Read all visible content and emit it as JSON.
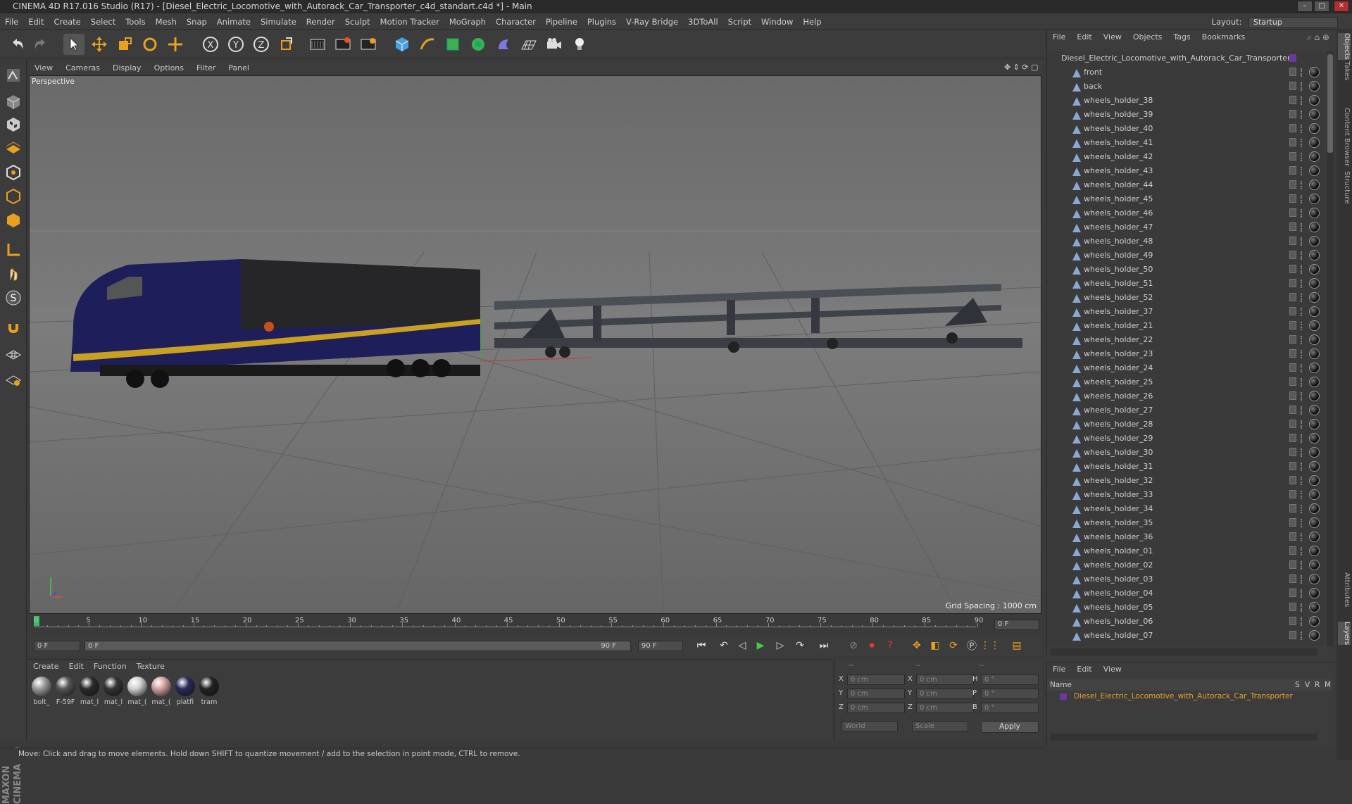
{
  "app": {
    "title": "CINEMA 4D R17.016 Studio (R17) - [Diesel_Electric_Locomotive_with_Autorack_Car_Transporter_c4d_standart.c4d *] - Main"
  },
  "menubar": [
    "File",
    "Edit",
    "Create",
    "Select",
    "Tools",
    "Mesh",
    "Snap",
    "Animate",
    "Simulate",
    "Render",
    "Sculpt",
    "Motion Tracker",
    "MoGraph",
    "Character",
    "Pipeline",
    "Plugins",
    "V-Ray Bridge",
    "3DToAll",
    "Script",
    "Window",
    "Help"
  ],
  "layout": {
    "label": "Layout:",
    "value": "Startup"
  },
  "viewport": {
    "menu": [
      "View",
      "Cameras",
      "Display",
      "Options",
      "Filter",
      "Panel"
    ],
    "label": "Perspective",
    "grid_spacing": "Grid Spacing : 1000 cm"
  },
  "timeline": {
    "ticks": [
      "0",
      "5",
      "10",
      "15",
      "20",
      "25",
      "30",
      "35",
      "40",
      "45",
      "50",
      "55",
      "60",
      "65",
      "70",
      "75",
      "80",
      "85",
      "90"
    ],
    "frame_field": "0 F"
  },
  "transport": {
    "start": "0 F",
    "range_start": "0 F",
    "range_end": "90 F",
    "end": "90 F"
  },
  "materials": {
    "menu": [
      "Create",
      "Edit",
      "Function",
      "Texture"
    ],
    "items": [
      {
        "name": "bolt_",
        "color": "#9a9a9a"
      },
      {
        "name": "F-59F",
        "color": "#555"
      },
      {
        "name": "mat_l",
        "color": "#2a2a2a"
      },
      {
        "name": "mat_l",
        "color": "#333"
      },
      {
        "name": "mat_(",
        "color": "#cfcfcf"
      },
      {
        "name": "mat_(",
        "color": "#d4a0a0"
      },
      {
        "name": "platfi",
        "color": "#2a2a5a"
      },
      {
        "name": "tram",
        "color": "#222"
      }
    ]
  },
  "coords": {
    "rows": [
      {
        "a": "X",
        "av": "0 cm",
        "b": "X",
        "bv": "0 cm",
        "c": "H",
        "cv": "0 °"
      },
      {
        "a": "Y",
        "av": "0 cm",
        "b": "Y",
        "bv": "0 cm",
        "c": "P",
        "cv": "0 °"
      },
      {
        "a": "Z",
        "av": "0 cm",
        "b": "Z",
        "bv": "0 cm",
        "c": "B",
        "cv": "0 °"
      }
    ],
    "world": "World",
    "scale": "Scale",
    "apply": "Apply",
    "header": [
      "--",
      "--",
      "--"
    ]
  },
  "status": "Move: Click and drag to move elements. Hold down SHIFT to quantize movement / add to the selection in point mode, CTRL to remove.",
  "objects": {
    "menu": [
      "File",
      "Edit",
      "View",
      "Objects",
      "Tags",
      "Bookmarks"
    ],
    "root": "Diesel_Electric_Locomotive_with_Autorack_Car_Transporter",
    "items": [
      "front",
      "back",
      "wheels_holder_38",
      "wheels_holder_39",
      "wheels_holder_40",
      "wheels_holder_41",
      "wheels_holder_42",
      "wheels_holder_43",
      "wheels_holder_44",
      "wheels_holder_45",
      "wheels_holder_46",
      "wheels_holder_47",
      "wheels_holder_48",
      "wheels_holder_49",
      "wheels_holder_50",
      "wheels_holder_51",
      "wheels_holder_52",
      "wheels_holder_37",
      "wheels_holder_21",
      "wheels_holder_22",
      "wheels_holder_23",
      "wheels_holder_24",
      "wheels_holder_25",
      "wheels_holder_26",
      "wheels_holder_27",
      "wheels_holder_28",
      "wheels_holder_29",
      "wheels_holder_30",
      "wheels_holder_31",
      "wheels_holder_32",
      "wheels_holder_33",
      "wheels_holder_34",
      "wheels_holder_35",
      "wheels_holder_36",
      "wheels_holder_01",
      "wheels_holder_02",
      "wheels_holder_03",
      "wheels_holder_04",
      "wheels_holder_05",
      "wheels_holder_06",
      "wheels_holder_07"
    ]
  },
  "sidetabs": [
    "Objects",
    "Takes",
    "Content Browser",
    "Structure",
    "Attributes",
    "Layers"
  ],
  "layers": {
    "menu": [
      "File",
      "Edit",
      "View"
    ],
    "header": {
      "name": "Name",
      "cols": [
        "S",
        "V",
        "R",
        "M"
      ]
    },
    "row": "Diesel_Electric_Locomotive_with_Autorack_Car_Transporter"
  },
  "logo": "MAXON CINEMA 4D"
}
